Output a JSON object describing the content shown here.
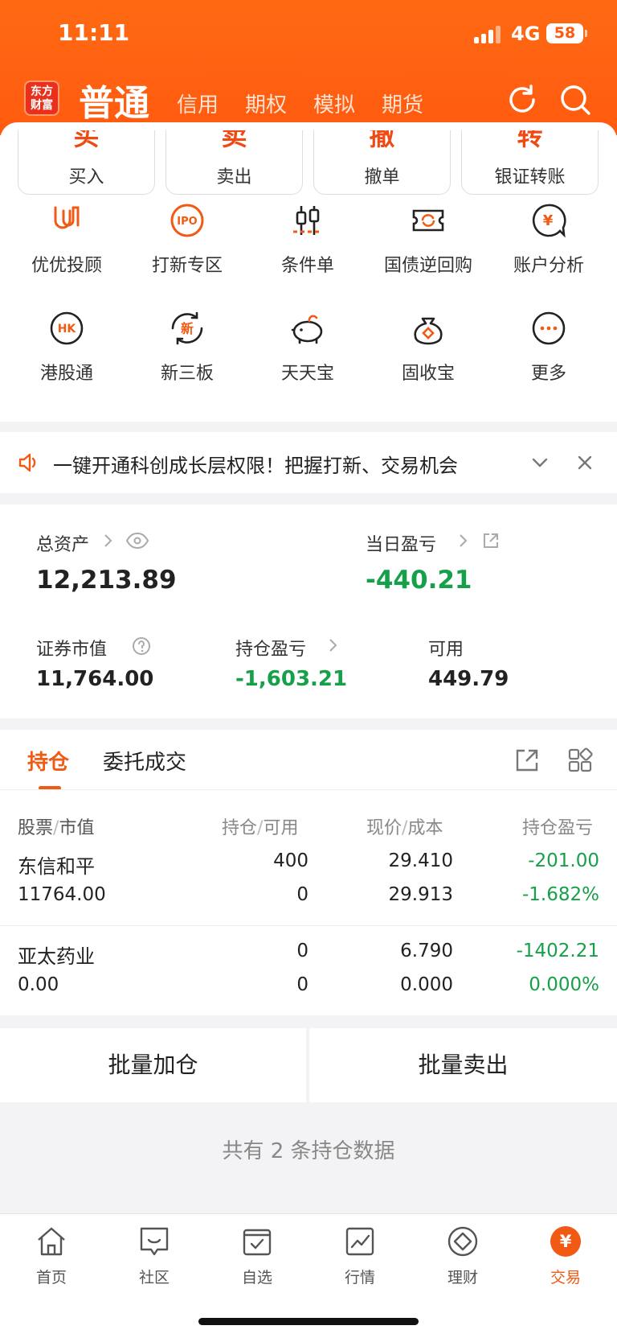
{
  "status_bar": {
    "time": "11:11",
    "network": "4G",
    "battery": "58"
  },
  "header": {
    "logo": "东方财富",
    "active_tab": "普通",
    "tabs": [
      "信用",
      "期权",
      "模拟",
      "期货"
    ]
  },
  "trade_buttons": [
    {
      "big": "买",
      "label": "买入"
    },
    {
      "big": "卖",
      "label": "卖出"
    },
    {
      "big": "撤",
      "label": "撤单"
    },
    {
      "big": "转",
      "label": "银证转账"
    }
  ],
  "functions": [
    {
      "label": "优优投顾",
      "icon": "youyou-icon"
    },
    {
      "label": "打新专区",
      "icon": "ipo-icon"
    },
    {
      "label": "条件单",
      "icon": "candlestick-icon"
    },
    {
      "label": "国债逆回购",
      "icon": "repo-ticket-icon"
    },
    {
      "label": "账户分析",
      "icon": "yuan-chat-icon"
    },
    {
      "label": "港股通",
      "icon": "hk-icon"
    },
    {
      "label": "新三板",
      "icon": "new-board-icon"
    },
    {
      "label": "天天宝",
      "icon": "piggy-bank-icon"
    },
    {
      "label": "固收宝",
      "icon": "money-bag-icon"
    },
    {
      "label": "更多",
      "icon": "more-icon"
    }
  ],
  "notice": {
    "text": "一键开通科创成长层权限！把握打新、交易机会"
  },
  "assets": {
    "total_label": "总资产",
    "total_value": "12,213.89",
    "daily_pl_label": "当日盈亏",
    "daily_pl_value": "-440.21",
    "market_value_label": "证券市值",
    "market_value": "11,764.00",
    "position_pl_label": "持仓盈亏",
    "position_pl_value": "-1,603.21",
    "available_label": "可用",
    "available_value": "449.79"
  },
  "holdings": {
    "tabs": [
      "持仓",
      "委托成交"
    ],
    "col_stock": "股票",
    "col_mv": "市值",
    "col_pos": "持仓",
    "col_avail": "可用",
    "col_price": "现价",
    "col_cost": "成本",
    "col_pl": "持仓盈亏",
    "rows": [
      {
        "name": "东信和平",
        "mv": "11764.00",
        "pos": "400",
        "avail": "0",
        "price": "29.410",
        "cost": "29.913",
        "pl": "-201.00",
        "pl_pct": "-1.682%"
      },
      {
        "name": "亚太药业",
        "mv": "0.00",
        "pos": "0",
        "avail": "0",
        "price": "6.790",
        "cost": "0.000",
        "pl": "-1402.21",
        "pl_pct": "0.000%"
      }
    ]
  },
  "batch": {
    "add": "批量加仓",
    "sell": "批量卖出"
  },
  "summary": "共有 2 条持仓数据",
  "tabbar": [
    {
      "label": "首页",
      "icon": "home-icon"
    },
    {
      "label": "社区",
      "icon": "community-icon"
    },
    {
      "label": "自选",
      "icon": "watchlist-icon"
    },
    {
      "label": "行情",
      "icon": "market-icon"
    },
    {
      "label": "理财",
      "icon": "wealth-icon"
    },
    {
      "label": "交易",
      "icon": "trade-yuan-icon"
    }
  ],
  "colors": {
    "brand": "#ff5a10",
    "loss": "#17a04a",
    "accent": "#f05a14"
  }
}
